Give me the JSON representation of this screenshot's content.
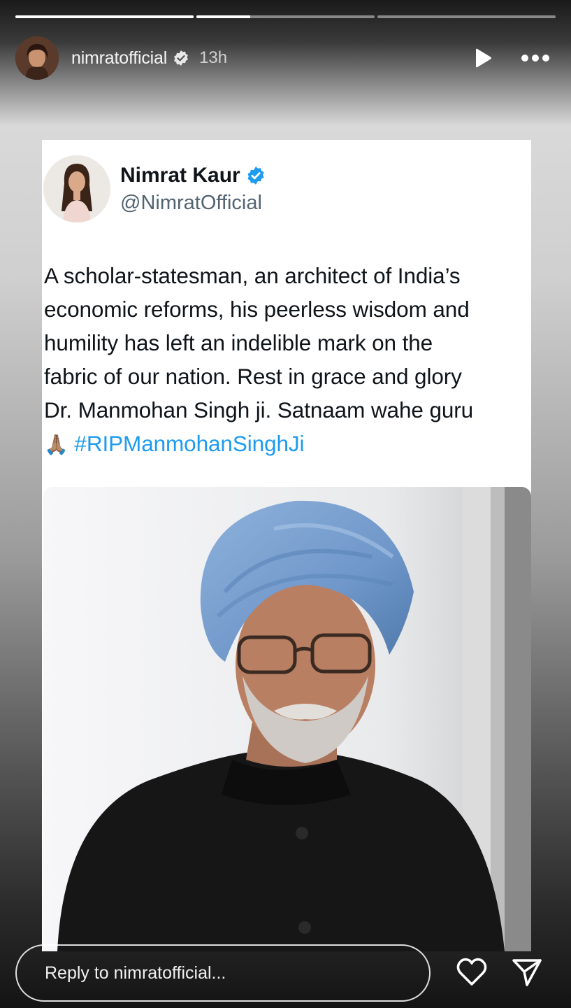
{
  "story": {
    "progress_segments": [
      1.0,
      0.3,
      0.0
    ],
    "username": "nimratofficial",
    "verified_icon": "verified-icon",
    "time": "13h",
    "play_icon": "play-icon",
    "more_icon": "more-icon"
  },
  "tweet": {
    "display_name": "Nimrat Kaur",
    "handle": "@NimratOfficial",
    "lines": [
      "A scholar-statesman, an architect of India’s",
      "economic reforms, his peerless wisdom and",
      "humility has left an indelible mark on the",
      "fabric of our nation. Rest in grace and glory",
      "Dr. Manmohan Singh ji. Satnaam wahe guru"
    ],
    "emoji": "🙏🏽",
    "hashtag": "#RIPManmohanSinghJi",
    "accent_color": "#1d9bf0"
  },
  "footer": {
    "reply_placeholder": "Reply to nimratofficial...",
    "heart_icon": "heart-icon",
    "send_icon": "send-icon"
  }
}
